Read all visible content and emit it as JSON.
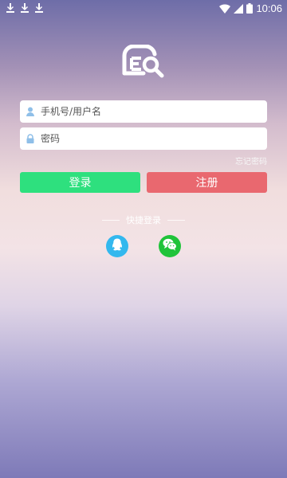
{
  "status_bar": {
    "time": "10:06",
    "left_icons": [
      "download-icon",
      "download-icon",
      "download-icon"
    ],
    "right_icons": [
      "wifi-icon",
      "signal-icon",
      "battery-icon"
    ]
  },
  "login": {
    "username_placeholder": "手机号/用户名",
    "username_value": "",
    "password_placeholder": "密码",
    "password_value": "",
    "forgot_label": "忘记密码",
    "login_label": "登录",
    "register_label": "注册"
  },
  "quick_login": {
    "label": "快捷登录",
    "options": [
      "qq-icon",
      "wechat-icon"
    ]
  },
  "colors": {
    "login_button": "#2ee07e",
    "register_button": "#e9686f",
    "qq": "#33b8ee",
    "wechat": "#20c33a",
    "field_icon": "#8fbfe8"
  }
}
